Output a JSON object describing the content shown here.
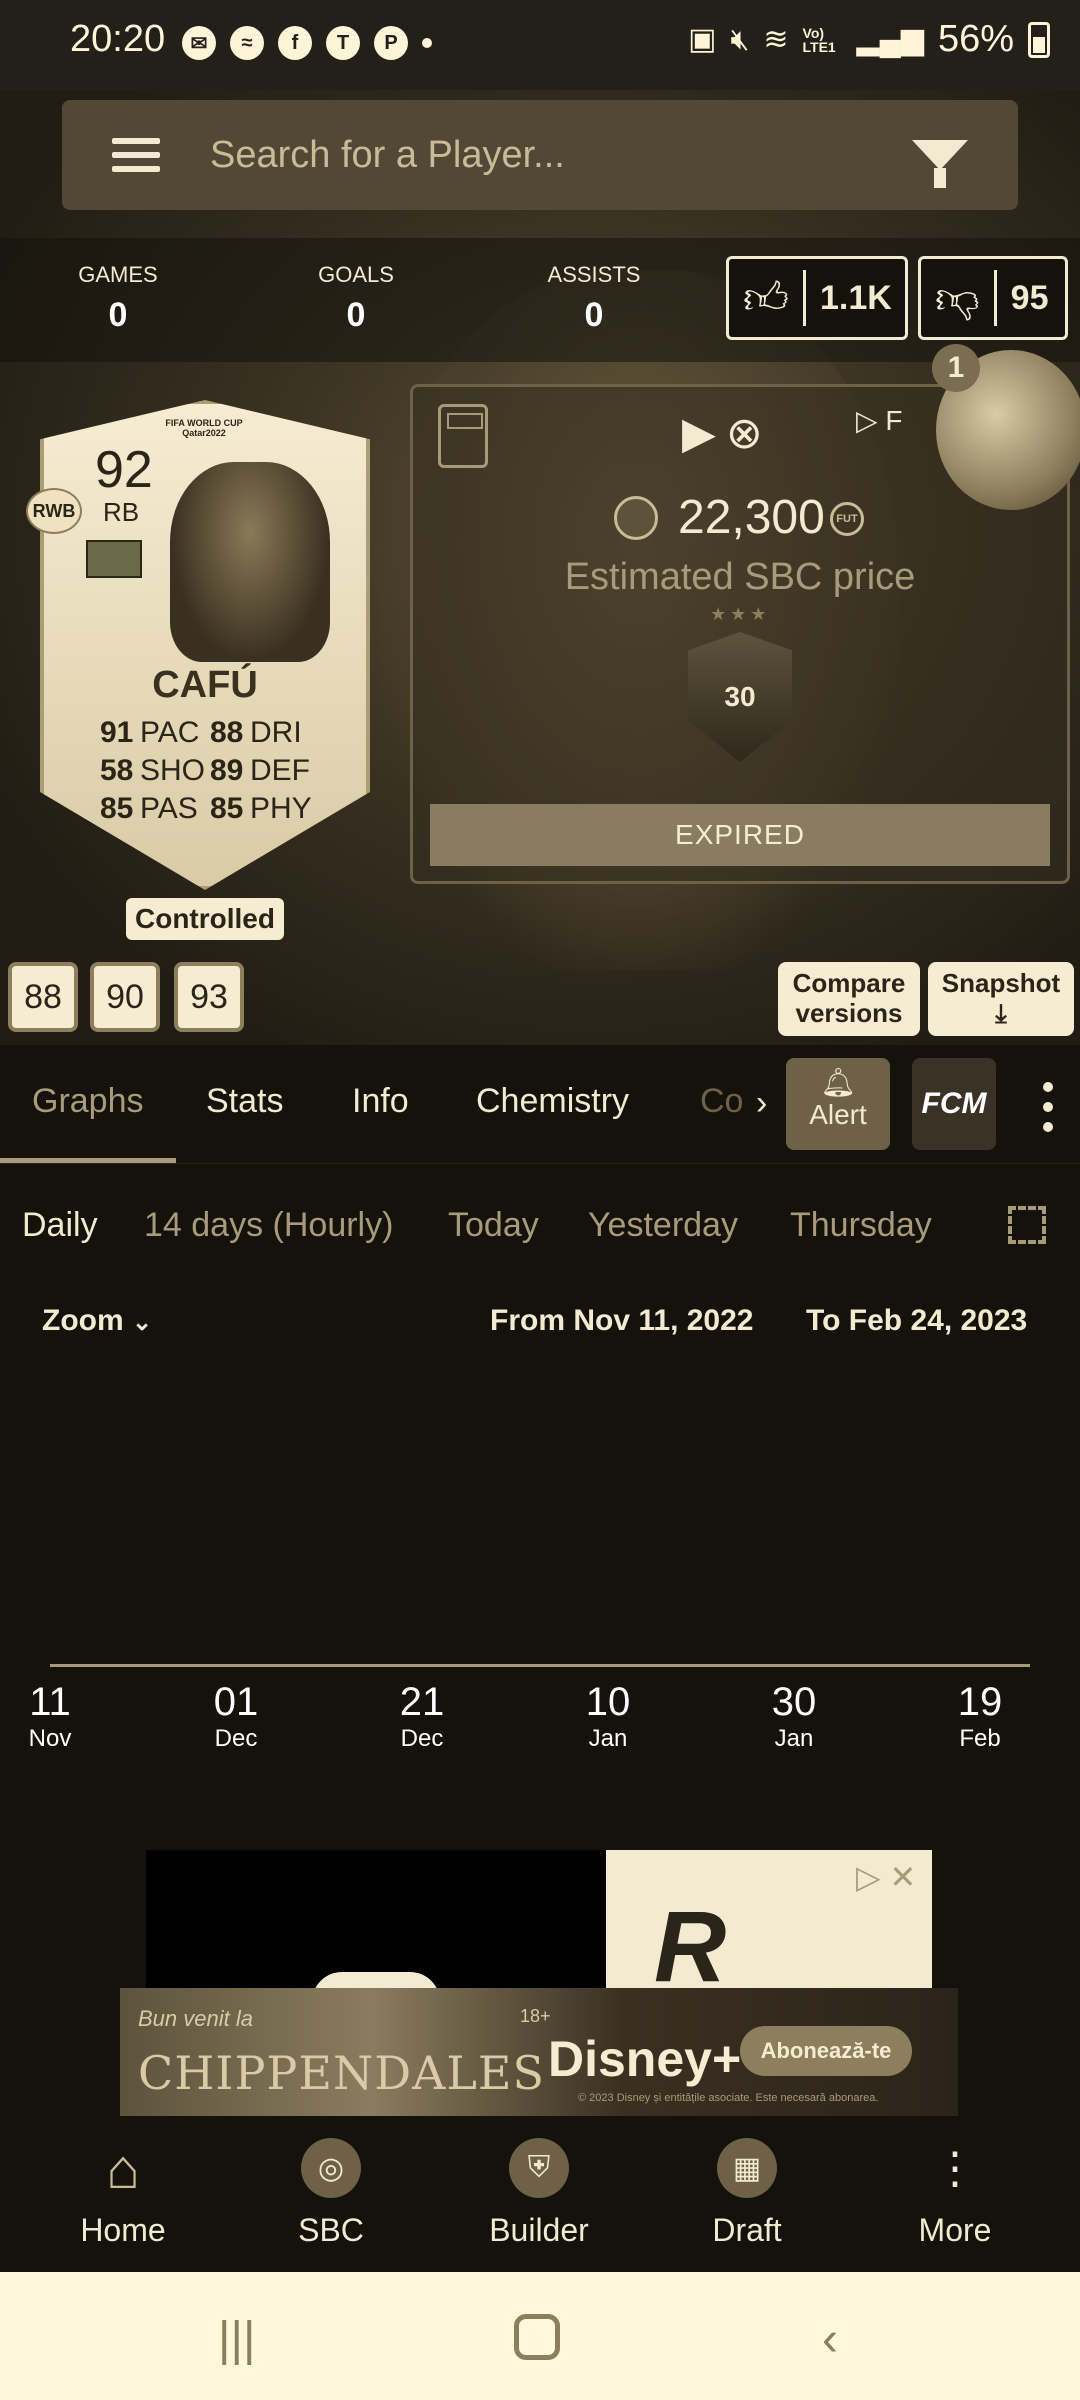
{
  "status_bar": {
    "time": "20:20",
    "battery": "56%",
    "app_icons": [
      "message-icon",
      "messenger-icon",
      "facebook-icon",
      "teams-icon",
      "pinterest-icon",
      "dot-icon"
    ],
    "signal_label": "Vo) LTE1"
  },
  "search": {
    "placeholder": "Search for a Player..."
  },
  "stats": {
    "games_label": "GAMES",
    "games_value": "0",
    "goals_label": "GOALS",
    "goals_value": "0",
    "assists_label": "ASSISTS",
    "assists_value": "0",
    "likes": "1.1K",
    "dislikes": "95"
  },
  "card": {
    "rating": "92",
    "position": "RB",
    "alt_position": "RWB",
    "header": "FIFA WORLD CUP Qatar2022",
    "name": "CAFÚ",
    "stats": [
      {
        "value": "91",
        "label": "PAC"
      },
      {
        "value": "88",
        "label": "DRI"
      },
      {
        "value": "58",
        "label": "SHO"
      },
      {
        "value": "89",
        "label": "DEF"
      },
      {
        "value": "85",
        "label": "PAS"
      },
      {
        "value": "85",
        "label": "PHY"
      }
    ],
    "status": "Controlled",
    "versions": [
      "88",
      "90",
      "93"
    ]
  },
  "price_panel": {
    "stores_text": "F",
    "price": "22,300",
    "price_label": "Estimated SBC price",
    "sbc_badge": "30",
    "expired_label": "EXPIRED",
    "notification_count": "1"
  },
  "actions": {
    "compare": "Compare versions",
    "compare_line1": "Compare",
    "compare_line2": "versions",
    "snapshot": "Snapshot"
  },
  "tabs": {
    "items": [
      "Graphs",
      "Stats",
      "Info",
      "Chemistry",
      "Co"
    ],
    "selected": "Graphs",
    "alert_label": "Alert",
    "fcm_label": "FCM"
  },
  "periods": {
    "items": [
      "Daily",
      "14 days (Hourly)",
      "Today",
      "Yesterday",
      "Thursday"
    ],
    "selected": "Daily"
  },
  "range": {
    "zoom_label": "Zoom",
    "from_label": "From",
    "from_value": "Nov 11, 2022",
    "to_label": "To",
    "to_value": "Feb 24, 2023"
  },
  "chart_data": {
    "type": "line",
    "title": "",
    "xlabel": "",
    "ylabel": "",
    "x": [
      "11 Nov",
      "01 Dec",
      "21 Dec",
      "10 Jan",
      "30 Jan",
      "19 Feb"
    ],
    "series": [],
    "x_ticks": [
      {
        "day": "11",
        "month": "Nov"
      },
      {
        "day": "01",
        "month": "Dec"
      },
      {
        "day": "21",
        "month": "Dec"
      },
      {
        "day": "10",
        "month": "Jan"
      },
      {
        "day": "30",
        "month": "Jan"
      },
      {
        "day": "19",
        "month": "Feb"
      }
    ]
  },
  "ads": {
    "ad1_letter": "R",
    "ad2_line1": "Bun venit la",
    "ad2_line2": "CHIPPENDALES",
    "ad2_rating": "18+",
    "ad2_brand": "Disney+",
    "ad2_cta": "Abonează-te",
    "ad2_disclaimer": "© 2023 Disney și entitățile asociate. Este necesară abonarea."
  },
  "bottom_nav": {
    "items": [
      "Home",
      "SBC",
      "Builder",
      "Draft",
      "More"
    ]
  },
  "colors": {
    "accent": "#a89b7b",
    "background": "#15120c",
    "card": "#f6ecd2"
  }
}
